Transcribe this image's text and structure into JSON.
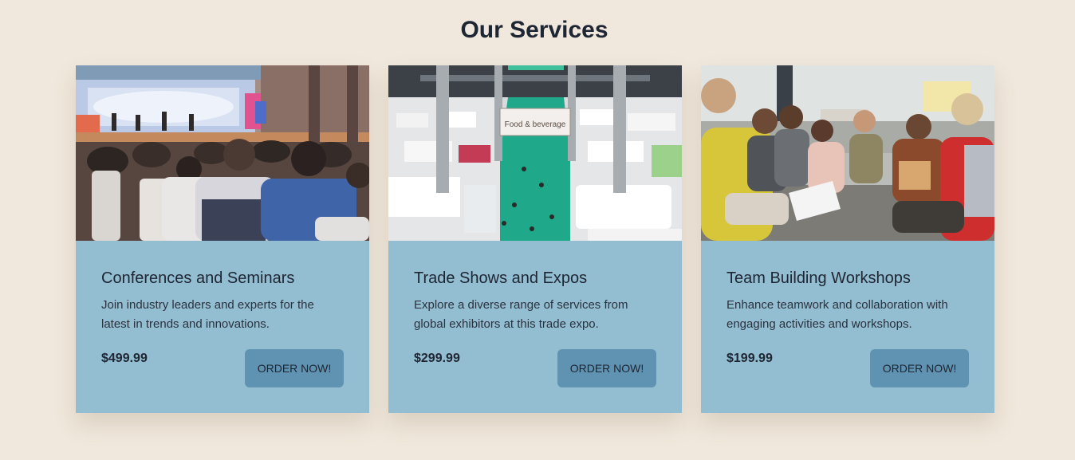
{
  "page": {
    "title": "Our Services"
  },
  "services": [
    {
      "image": "conference-audience-photo",
      "title": "Conferences and Seminars",
      "description": "Join industry leaders and experts for the latest in trends and innovations.",
      "price": "$499.99",
      "button_label": "ORDER NOW!"
    },
    {
      "image": "trade-show-hall-photo",
      "image_sign": "Food & beverage",
      "title": "Trade Shows and Expos",
      "description": "Explore a diverse range of services from global exhibitors at this trade expo.",
      "price": "$299.99",
      "button_label": "ORDER NOW!"
    },
    {
      "image": "team-workshop-photo",
      "title": "Team Building Workshops",
      "description": "Enhance teamwork and collaboration with engaging activities and workshops.",
      "price": "$199.99",
      "button_label": "ORDER NOW!"
    }
  ],
  "colors": {
    "page_background": "#f0e8dc",
    "card_background": "#93bdd0",
    "button_background": "#6093b1",
    "text": "#1e2533"
  }
}
